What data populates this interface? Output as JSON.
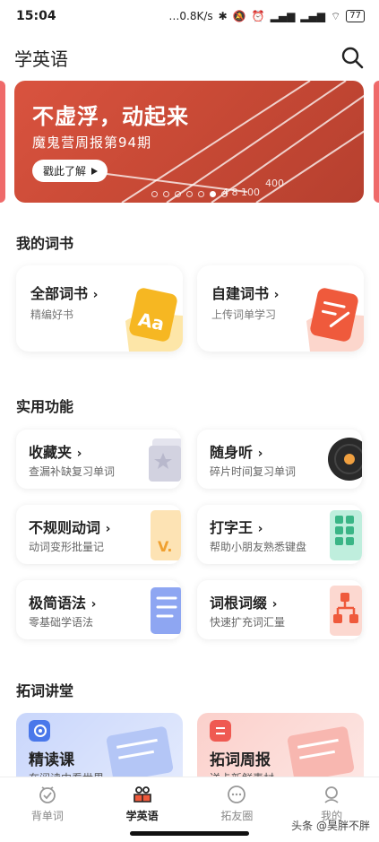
{
  "status_bar": {
    "time": "15:04",
    "network_speed": "…0.8K/s",
    "battery": "77"
  },
  "header": {
    "title": "学英语"
  },
  "banner": {
    "headline": "不虚浮，动起来",
    "subtitle": "魔鬼营周报第94期",
    "cta": "戳此了解",
    "track_numbers": [
      "400",
      "4 8 100"
    ],
    "pages": 7,
    "active_page": 5
  },
  "my_books": {
    "title": "我的词书",
    "cards": [
      {
        "name": "全部词书",
        "desc": "精编好书",
        "icon": "aa-book-icon"
      },
      {
        "name": "自建词书",
        "desc": "上传词单学习",
        "icon": "edit-note-icon"
      }
    ]
  },
  "tools": {
    "title": "实用功能",
    "items": [
      {
        "name": "收藏夹",
        "desc": "查漏补缺复习单词"
      },
      {
        "name": "随身听",
        "desc": "碎片时间复习单词"
      },
      {
        "name": "不规则动词",
        "desc": "动词变形批量记"
      },
      {
        "name": "打字王",
        "desc": "帮助小朋友熟悉键盘"
      },
      {
        "name": "极简语法",
        "desc": "零基础学语法"
      },
      {
        "name": "词根词缀",
        "desc": "快速扩充词汇量"
      }
    ],
    "verb_art_text": "V."
  },
  "lectures": {
    "title": "拓词讲堂",
    "items": [
      {
        "name": "精读课",
        "desc": "在阅读中看世界"
      },
      {
        "name": "拓词周报",
        "desc": "送卡新鲜素材"
      }
    ]
  },
  "nav": {
    "items": [
      {
        "label": "背单词",
        "icon": "clock-check-icon"
      },
      {
        "label": "学英语",
        "icon": "reading-icon",
        "active": true
      },
      {
        "label": "拓友圈",
        "icon": "chat-bubble-icon"
      },
      {
        "label": "我的",
        "icon": "profile-icon"
      }
    ]
  },
  "watermark": "头条 @昊胖不胖"
}
